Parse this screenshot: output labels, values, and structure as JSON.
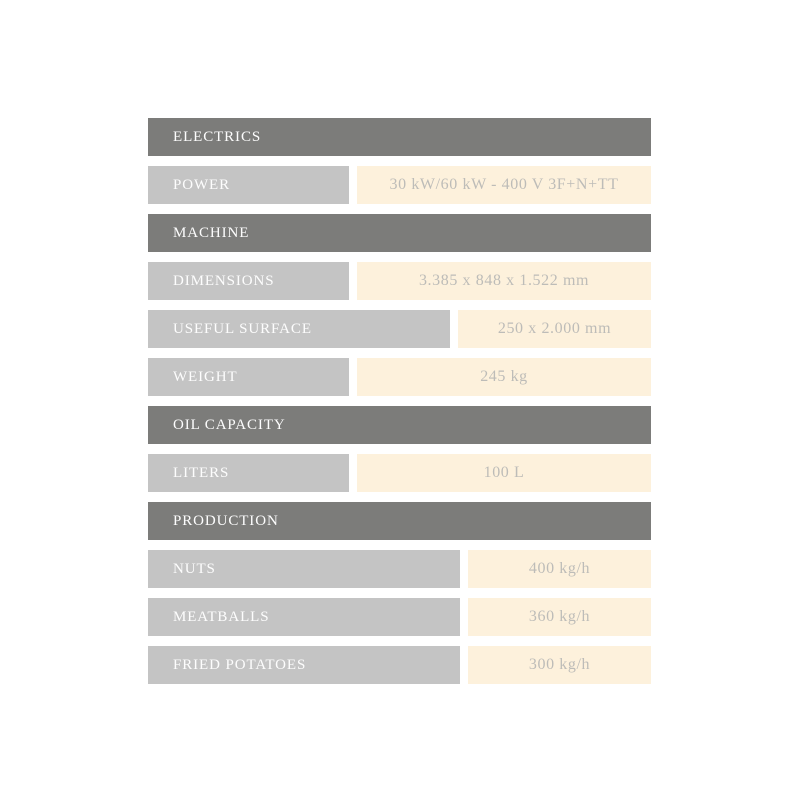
{
  "colors": {
    "section_bg": "#7c7c7a",
    "label_bg": "#c4c4c4",
    "value_bg": "#fdf1dc",
    "section_text": "#fdfdfd",
    "label_text": "#fdfdfd",
    "value_text": "#bdbcb8",
    "page_bg": "#ffffff"
  },
  "table": {
    "rows": [
      {
        "kind": "section",
        "label": "ELECTRICS"
      },
      {
        "kind": "data",
        "label": "POWER",
        "value": "30 kW/60 kW - 400 V 3F+N+TT",
        "label_width": "w-201"
      },
      {
        "kind": "section",
        "label": "MACHINE"
      },
      {
        "kind": "data",
        "label": "DIMENSIONS",
        "value": "3.385 x 848 x 1.522 mm",
        "label_width": "w-201"
      },
      {
        "kind": "data",
        "label": "USEFUL SURFACE",
        "value": "250 x 2.000 mm",
        "label_width": "w-302"
      },
      {
        "kind": "data",
        "label": "WEIGHT",
        "value": "245 kg",
        "label_width": "w-201"
      },
      {
        "kind": "section",
        "label": "OIL CAPACITY"
      },
      {
        "kind": "data",
        "label": "LITERS",
        "value": "100 L",
        "label_width": "w-201"
      },
      {
        "kind": "section",
        "label": "PRODUCTION"
      },
      {
        "kind": "data",
        "label": "NUTS",
        "value": "400 kg/h",
        "label_width": "w-312"
      },
      {
        "kind": "data",
        "label": "MEATBALLS",
        "value": "360 kg/h",
        "label_width": "w-312"
      },
      {
        "kind": "data",
        "label": "FRIED POTATOES",
        "value": "300 kg/h",
        "label_width": "w-312"
      }
    ]
  }
}
